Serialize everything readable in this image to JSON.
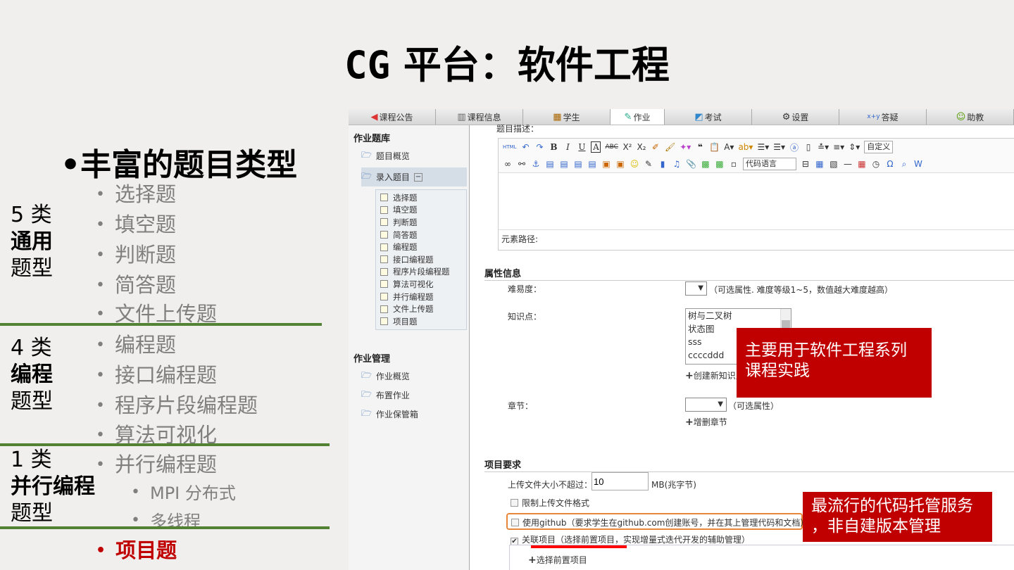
{
  "slide": {
    "title_latin": "CG",
    "title_rest": " 平台：软件工程",
    "heading": "丰富的题目类型",
    "items": [
      "选择题",
      "填空题",
      "判断题",
      "简答题",
      "文件上传题",
      "编程题",
      "接口编程题",
      "程序片段编程题",
      "算法可视化",
      "并行编程题"
    ],
    "subitems": [
      "MPI 分布式",
      "多线程"
    ],
    "highlight_item": "项目题",
    "categories": [
      {
        "count": "5 类",
        "name": "通用",
        "suffix": "题型"
      },
      {
        "count": "4 类",
        "name": "编程",
        "suffix": "题型"
      },
      {
        "count": "1 类",
        "name": "并行编程",
        "suffix": "题型"
      }
    ],
    "colors": {
      "divider": "#548235",
      "highlight": "#c00000",
      "callout": "#c00000"
    }
  },
  "app": {
    "tabs": [
      {
        "label": "课程公告",
        "icon": "speaker-icon"
      },
      {
        "label": "课程信息",
        "icon": "book-icon"
      },
      {
        "label": "学生",
        "icon": "students-icon"
      },
      {
        "label": "作业",
        "icon": "homework-icon",
        "active": true
      },
      {
        "label": "考试",
        "icon": "exam-icon"
      },
      {
        "label": "设置",
        "icon": "gear-icon"
      },
      {
        "label": "答疑",
        "icon": "qa-icon"
      },
      {
        "label": "助教",
        "icon": "assistant-icon"
      }
    ],
    "nav": {
      "bank_title": "作业题库",
      "overview": "题目概览",
      "enter": "录入题目",
      "types": [
        "选择题",
        "填空题",
        "判断题",
        "简答题",
        "编程题",
        "接口编程题",
        "程序片段编程题",
        "算法可视化",
        "并行编程题",
        "文件上传题",
        "项目题"
      ],
      "manage_title": "作业管理",
      "manage": [
        "作业概览",
        "布置作业",
        "作业保管箱"
      ]
    },
    "editor": {
      "label": "题目描述：",
      "code_lang": "代码语言",
      "custom": "自定义",
      "path_label": "元素路径:"
    },
    "attrs": {
      "title": "属性信息",
      "difficulty_label": "难易度：",
      "difficulty_hint": "（可选属性. 难度等级1~5，数值越大难度越高）",
      "knowledge_label": "知识点：",
      "knowledge_options": [
        "树与二叉树",
        "状态图",
        "sss",
        "ccccddd"
      ],
      "create_knowledge": "创建新知识点",
      "chapter_label": "章节：",
      "chapter_hint": "（可选属性）",
      "edit_chapter": "增删章节"
    },
    "project": {
      "title": "项目要求",
      "size_label": "上传文件大小不超过：",
      "size_value": "10",
      "size_unit": "MB(兆字节)",
      "limit_format": "限制上传文件格式",
      "limit_format_checked": false,
      "github": "使用github（要求学生在github.com创建账号，并在其上管理代码和文档）",
      "github_checked": false,
      "link_project": "关联项目（选择前置项目，实现增量式迭代开发的辅助管理）",
      "link_project_checked": true,
      "select_prev": "选择前置项目"
    }
  },
  "callouts": {
    "first": [
      "主要用于软件工程系列",
      "课程实践"
    ],
    "second": [
      "最流行的代码托管服务",
      "，非自建版本管理"
    ]
  }
}
